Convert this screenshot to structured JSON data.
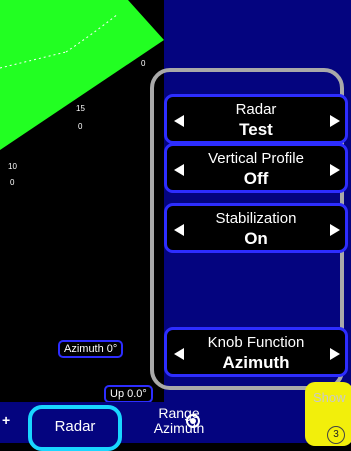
{
  "top_readout": "   ",
  "range_rings": [
    {
      "label": "0"
    },
    {
      "label": "15"
    },
    {
      "label": "0"
    },
    {
      "label": "10"
    },
    {
      "label": "0"
    }
  ],
  "controls": {
    "radar": {
      "label": "Radar",
      "value": "Test"
    },
    "vertical_profile": {
      "label": "Vertical Profile",
      "value": "Off"
    },
    "stabilization": {
      "label": "Stabilization",
      "value": "On"
    },
    "knob_function": {
      "label": "Knob Function",
      "value": "Azimuth"
    }
  },
  "azimuth_readout": "Azimuth 0°",
  "up_readout": "Up 0.0°",
  "bottom": {
    "plus": "+",
    "radar_tab": "Radar",
    "range_line1": "Range",
    "range_line2": "Azimuth",
    "show_label": "Show",
    "show_badge": "3"
  },
  "colors": {
    "panel_blue": "#04047f",
    "control_border": "#2d2dff",
    "sweep_green": "#22ff22",
    "active_tab_border": "#19d6ff",
    "show_button": "#f2ef0b",
    "group_frame": "#a9a9a9"
  }
}
